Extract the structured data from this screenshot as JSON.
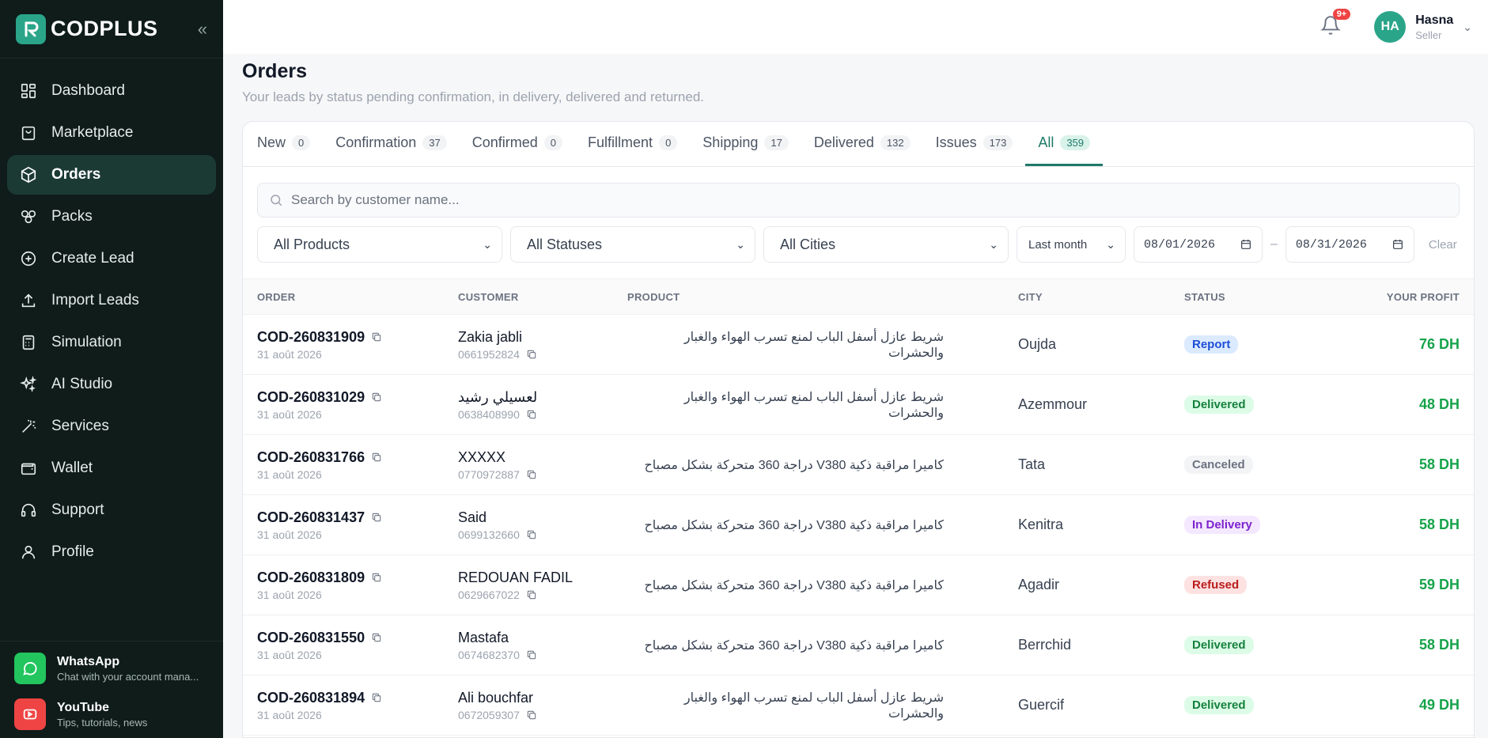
{
  "sidebar": {
    "brand": "CODPLUS",
    "items": [
      {
        "label": "Dashboard",
        "icon": "dashboard-icon"
      },
      {
        "label": "Marketplace",
        "icon": "shopping-bag-icon"
      },
      {
        "label": "Orders",
        "icon": "box-icon"
      },
      {
        "label": "Packs",
        "icon": "packs-icon"
      },
      {
        "label": "Create Lead",
        "icon": "plus-circle-icon"
      },
      {
        "label": "Import Leads",
        "icon": "upload-icon"
      },
      {
        "label": "Simulation",
        "icon": "calculator-icon"
      },
      {
        "label": "AI Studio",
        "icon": "sparkles-icon"
      },
      {
        "label": "Services",
        "icon": "magic-wand-icon"
      },
      {
        "label": "Wallet",
        "icon": "wallet-icon"
      },
      {
        "label": "Support",
        "icon": "headset-icon"
      },
      {
        "label": "Profile",
        "icon": "user-icon"
      }
    ],
    "active": "Orders",
    "promos": [
      {
        "title": "WhatsApp",
        "subtitle": "Chat with your account mana...",
        "color": "#22c55e"
      },
      {
        "title": "YouTube",
        "subtitle": "Tips, tutorials, news",
        "color": "#ef4444"
      }
    ]
  },
  "topbar": {
    "notification_badge": "9+",
    "user": {
      "initials": "HA",
      "name": "Hasna",
      "role": "Seller"
    }
  },
  "page": {
    "title": "Orders",
    "subtitle": "Your leads by status pending confirmation, in delivery, delivered and returned."
  },
  "tabs": [
    {
      "label": "New",
      "count": "0"
    },
    {
      "label": "Confirmation",
      "count": "37"
    },
    {
      "label": "Confirmed",
      "count": "0"
    },
    {
      "label": "Fulfillment",
      "count": "0"
    },
    {
      "label": "Shipping",
      "count": "17"
    },
    {
      "label": "Delivered",
      "count": "132"
    },
    {
      "label": "Issues",
      "count": "173"
    },
    {
      "label": "All",
      "count": "359"
    }
  ],
  "active_tab": "All",
  "filters": {
    "search_placeholder": "Search by customer name...",
    "products": "All Products",
    "statuses": "All Statuses",
    "cities": "All Cities",
    "period": "Last month",
    "date_from": "08/01/2026",
    "date_to": "08/31/2026",
    "clear": "Clear"
  },
  "table": {
    "headers": [
      "ORDER",
      "CUSTOMER",
      "PRODUCT",
      "CITY",
      "STATUS",
      "YOUR PROFIT"
    ],
    "rows": [
      {
        "order": "COD-260831909",
        "date": "31 août 2026",
        "customer": "Zakia jabli",
        "phone": "0661952824",
        "product": "شريط عازل أسفل الباب لمنع تسرب الهواء والغبار والحشرات",
        "city": "Oujda",
        "status": "Report",
        "profit": "76 DH"
      },
      {
        "order": "COD-260831029",
        "date": "31 août 2026",
        "customer": "لعسيلي رشيد",
        "phone": "0638408990",
        "product": "شريط عازل أسفل الباب لمنع تسرب الهواء والغبار والحشرات",
        "city": "Azemmour",
        "status": "Delivered",
        "profit": "48 DH"
      },
      {
        "order": "COD-260831766",
        "date": "31 août 2026",
        "customer": "XXXXX",
        "phone": "0770972887",
        "product": "كاميرا مراقبة ذكية V380 دراجة 360 متحركة بشكل مصباح",
        "city": "Tata",
        "status": "Canceled",
        "profit": "58 DH"
      },
      {
        "order": "COD-260831437",
        "date": "31 août 2026",
        "customer": "Said",
        "phone": "0699132660",
        "product": "كاميرا مراقبة ذكية V380 دراجة 360 متحركة بشكل مصباح",
        "city": "Kenitra",
        "status": "In Delivery",
        "profit": "58 DH"
      },
      {
        "order": "COD-260831809",
        "date": "31 août 2026",
        "customer": "REDOUAN FADIL",
        "phone": "0629667022",
        "product": "كاميرا مراقبة ذكية V380 دراجة 360 متحركة بشكل مصباح",
        "city": "Agadir",
        "status": "Refused",
        "profit": "59 DH"
      },
      {
        "order": "COD-260831550",
        "date": "31 août 2026",
        "customer": "Mastafa",
        "phone": "0674682370",
        "product": "كاميرا مراقبة ذكية V380 دراجة 360 متحركة بشكل مصباح",
        "city": "Berrchid",
        "status": "Delivered",
        "profit": "58 DH"
      },
      {
        "order": "COD-260831894",
        "date": "31 août 2026",
        "customer": "Ali bouchfar",
        "phone": "0672059307",
        "product": "شريط عازل أسفل الباب لمنع تسرب الهواء والغبار والحشرات",
        "city": "Guercif",
        "status": "Delivered",
        "profit": "49 DH"
      }
    ]
  },
  "status_colors": {
    "Report": {
      "bg": "#dbeafe",
      "fg": "#1d4ed8"
    },
    "Delivered": {
      "bg": "#dcfce7",
      "fg": "#15803d"
    },
    "Canceled": {
      "bg": "#f3f4f6",
      "fg": "#6b7280"
    },
    "In Delivery": {
      "bg": "#f3e8ff",
      "fg": "#7e22ce"
    },
    "Refused": {
      "bg": "#fee2e2",
      "fg": "#b91c1c"
    }
  }
}
